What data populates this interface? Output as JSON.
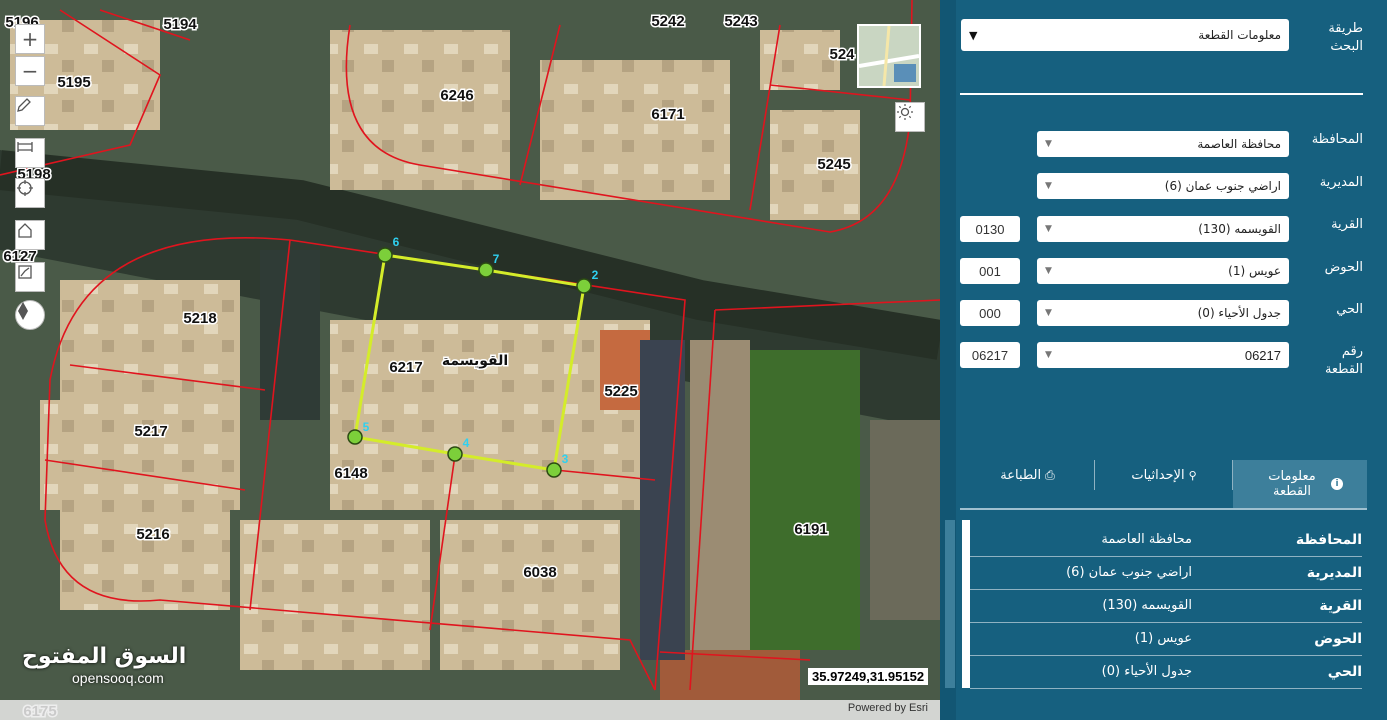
{
  "map": {
    "parcel_labels": [
      {
        "id": "5196",
        "text": "5196"
      },
      {
        "id": "5194",
        "text": "5194"
      },
      {
        "id": "5195",
        "text": "5195"
      },
      {
        "id": "5198",
        "text": "5198"
      },
      {
        "id": "6127",
        "text": "6127"
      },
      {
        "id": "5242",
        "text": "5242"
      },
      {
        "id": "5243",
        "text": "5243"
      },
      {
        "id": "524",
        "text": "524"
      },
      {
        "id": "6246",
        "text": "6246"
      },
      {
        "id": "6171",
        "text": "6171"
      },
      {
        "id": "5245",
        "text": "5245"
      },
      {
        "id": "5218",
        "text": "5218"
      },
      {
        "id": "6217",
        "text": "6217"
      },
      {
        "id": "5225",
        "text": "5225"
      },
      {
        "id": "5217",
        "text": "5217"
      },
      {
        "id": "6148",
        "text": "6148"
      },
      {
        "id": "5216",
        "text": "5216"
      },
      {
        "id": "6038",
        "text": "6038"
      },
      {
        "id": "6191",
        "text": "6191"
      },
      {
        "id": "6175",
        "text": "6175"
      }
    ],
    "place_label": "القويسمة",
    "vertices": [
      "6",
      "7",
      "2",
      "3",
      "4",
      "5"
    ],
    "coordinates": "35.97249,31.95152",
    "attribution": "Powered by Esri",
    "logo_ar": "السوق المفتوح",
    "logo_en": "opensooq.com",
    "controls": {
      "zoom_in": "+",
      "zoom_out": "−"
    },
    "colors": {
      "parcel_line": "#e0141e",
      "selection_line": "#d4ec2a",
      "vertex": "#7ccf3a"
    }
  },
  "panel": {
    "search_method": {
      "label": "طريقة البحث",
      "value": "معلومات القطعة"
    },
    "governorate": {
      "label": "المحافظة",
      "value": "محافظة العاصمة"
    },
    "directorate": {
      "label": "المديرية",
      "value": "اراضي جنوب عمان (6)"
    },
    "village": {
      "label": "القرية",
      "value": "القويسمه (130)",
      "code": "0130"
    },
    "basin": {
      "label": "الحوض",
      "value": "عويس (1)",
      "code": "001"
    },
    "district": {
      "label": "الحي",
      "value": "جدول الأحياء (0)",
      "code": "000"
    },
    "parcel": {
      "label": "رقم القطعة",
      "value": "06217",
      "code": "06217"
    },
    "tabs": {
      "info": "معلومات القطعة",
      "coords": "الإحداثيات",
      "print": "الطباعة"
    },
    "info_rows": [
      {
        "k": "المحافظة",
        "v": "محافظة العاصمة"
      },
      {
        "k": "المديرية",
        "v": "اراضي جنوب عمان (6)"
      },
      {
        "k": "القرية",
        "v": "القويسمه (130)"
      },
      {
        "k": "الحوض",
        "v": "عويس (1)"
      },
      {
        "k": "الحي",
        "v": "جدول الأحياء (0)"
      }
    ]
  }
}
